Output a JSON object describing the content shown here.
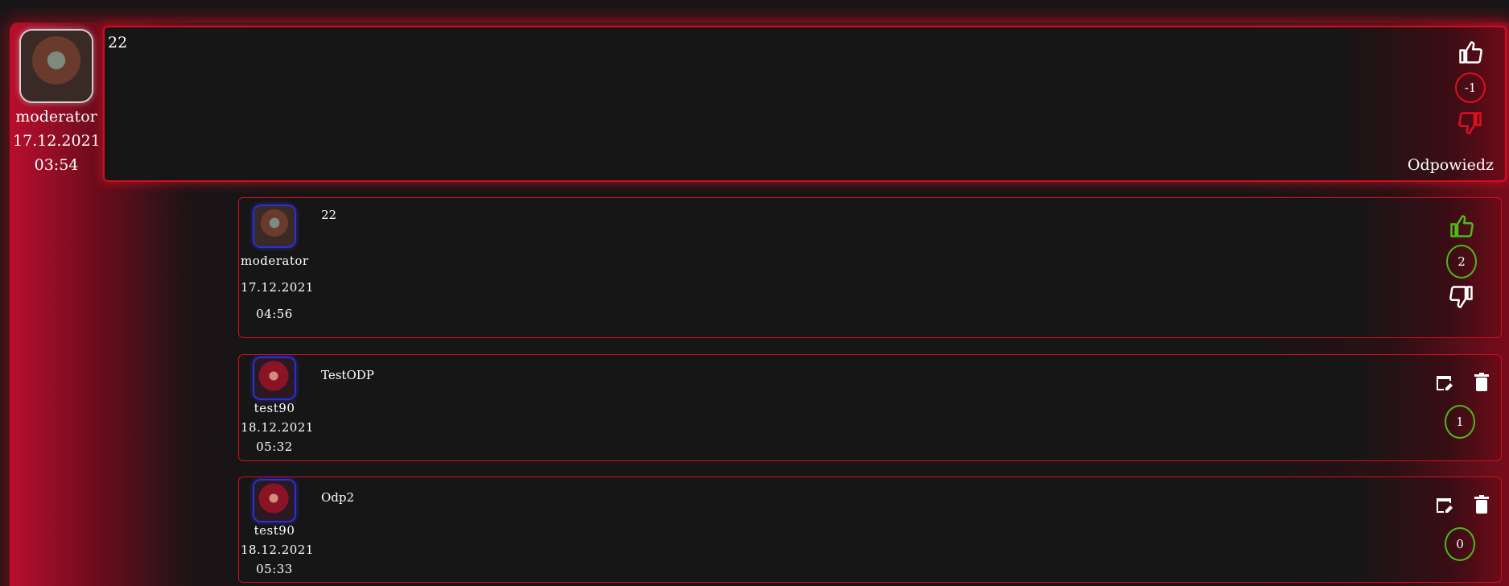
{
  "main_post": {
    "author": "moderator",
    "date": "17.12.2021",
    "time": "03:54",
    "text": "22",
    "score": "-1",
    "reply_label": "Odpowiedz"
  },
  "replies": [
    {
      "author": "moderator",
      "date": "17.12.2021",
      "time": "04:56",
      "text": "22",
      "score": "2"
    },
    {
      "author": "test90",
      "date": "18.12.2021",
      "time": "05:32",
      "text": "TestODP",
      "score": "1"
    },
    {
      "author": "test90",
      "date": "18.12.2021",
      "time": "05:33",
      "text": "Odp2",
      "score": "0"
    }
  ],
  "colors": {
    "accent_red": "#d40c1f",
    "glow_red": "#b80f2e",
    "vote_green": "#4fb81a",
    "avatar_border_blue": "#2a2fd6"
  },
  "icons": {
    "upvote": "thumbs-up-icon",
    "downvote": "thumbs-down-icon",
    "edit": "edit-icon",
    "delete": "trash-icon"
  }
}
